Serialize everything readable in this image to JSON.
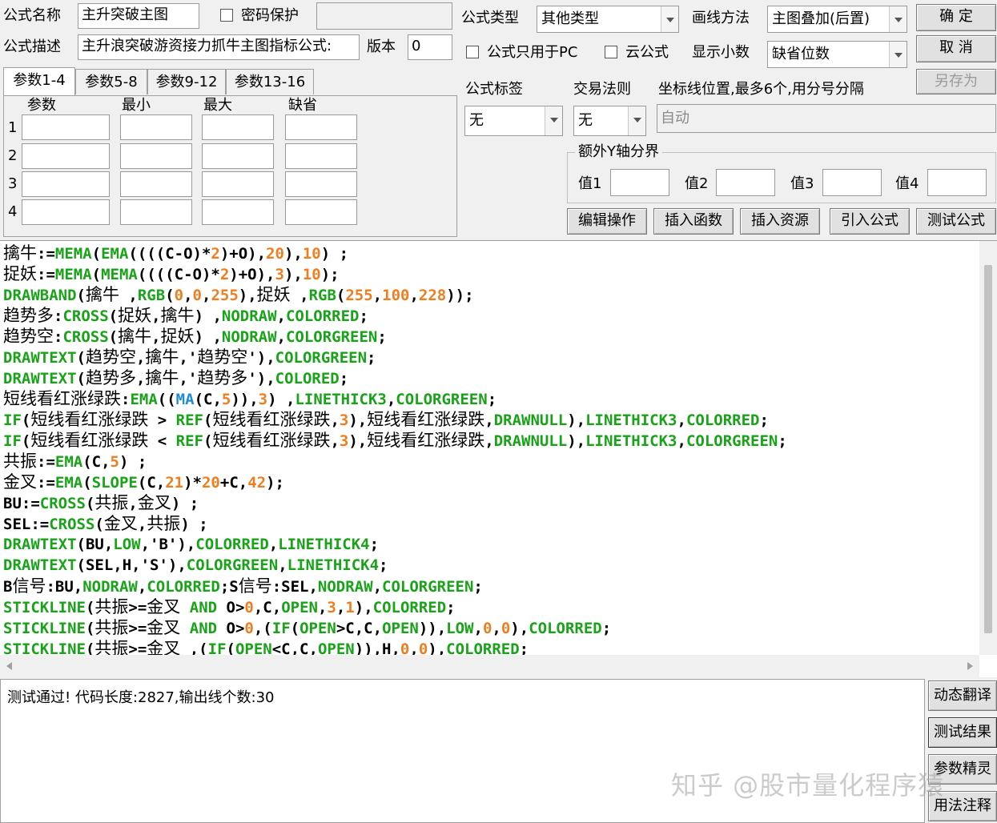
{
  "top": {
    "formula_name_label": "公式名称",
    "formula_name_value": "主升突破主图",
    "password_label": "密码保护",
    "formula_desc_label": "公式描述",
    "formula_desc_value": "主升浪突破游资接力抓牛主图指标公式:",
    "version_label": "版本",
    "version_value": "0",
    "formula_type_label": "公式类型",
    "formula_type_value": "其他类型",
    "draw_method_label": "画线方法",
    "draw_method_value": "主图叠加(后置)",
    "pc_only_label": "公式只用于PC",
    "cloud_label": "云公式",
    "decimals_label": "显示小数",
    "decimals_value": "缺省位数",
    "ok_button": "确 定",
    "cancel_button": "取 消",
    "save_as_button": "另存为"
  },
  "tabs": [
    "参数1-4",
    "参数5-8",
    "参数9-12",
    "参数13-16"
  ],
  "params": {
    "headers": [
      "参数",
      "最小",
      "最大",
      "缺省"
    ],
    "rows": [
      "1",
      "2",
      "3",
      "4"
    ]
  },
  "right": {
    "tag_label": "公式标签",
    "tag_value": "无",
    "trade_rule_label": "交易法则",
    "trade_rule_value": "无",
    "axis_label": "坐标线位置,最多6个,用分号分隔",
    "axis_placeholder": "自动",
    "extra_y_label": "额外Y轴分界",
    "value_labels": [
      "值1",
      "值2",
      "值3",
      "值4"
    ]
  },
  "action_buttons": [
    "编辑操作",
    "插入函数",
    "插入资源",
    "引入公式",
    "测试公式"
  ],
  "code_lines": [
    [
      [
        "cn",
        "擒牛"
      ],
      [
        "k",
        ":="
      ],
      [
        "g",
        "MEMA"
      ],
      [
        "k",
        "("
      ],
      [
        "g",
        "EMA"
      ],
      [
        "k",
        "((((C-O)*"
      ],
      [
        "o",
        "2"
      ],
      [
        "k",
        ")+O),"
      ],
      [
        "o",
        "20"
      ],
      [
        "k",
        "),"
      ],
      [
        "o",
        "10"
      ],
      [
        "k",
        ") ;"
      ]
    ],
    [
      [
        "cn",
        "捉妖"
      ],
      [
        "k",
        ":="
      ],
      [
        "g",
        "MEMA"
      ],
      [
        "k",
        "("
      ],
      [
        "g",
        "MEMA"
      ],
      [
        "k",
        "((((C-O)*"
      ],
      [
        "o",
        "2"
      ],
      [
        "k",
        ")+O),"
      ],
      [
        "o",
        "3"
      ],
      [
        "k",
        "),"
      ],
      [
        "o",
        "10"
      ],
      [
        "k",
        ");"
      ]
    ],
    [
      [
        "g",
        "DRAWBAND"
      ],
      [
        "k",
        "("
      ],
      [
        "cn",
        "擒牛"
      ],
      [
        "k",
        " ,"
      ],
      [
        "g",
        "RGB"
      ],
      [
        "k",
        "("
      ],
      [
        "o",
        "0"
      ],
      [
        "k",
        ","
      ],
      [
        "o",
        "0"
      ],
      [
        "k",
        ","
      ],
      [
        "o",
        "255"
      ],
      [
        "k",
        "),"
      ],
      [
        "cn",
        "捉妖"
      ],
      [
        "k",
        " ,"
      ],
      [
        "g",
        "RGB"
      ],
      [
        "k",
        "("
      ],
      [
        "o",
        "255"
      ],
      [
        "k",
        ","
      ],
      [
        "o",
        "100"
      ],
      [
        "k",
        ","
      ],
      [
        "o",
        "228"
      ],
      [
        "k",
        "));"
      ]
    ],
    [
      [
        "cn",
        "趋势多"
      ],
      [
        "k",
        ":"
      ],
      [
        "g",
        "CROSS"
      ],
      [
        "k",
        "("
      ],
      [
        "cn",
        "捉妖"
      ],
      [
        "k",
        ","
      ],
      [
        "cn",
        "擒牛"
      ],
      [
        "k",
        ") ,"
      ],
      [
        "g",
        "NODRAW"
      ],
      [
        "k",
        ","
      ],
      [
        "g",
        "COLORRED"
      ],
      [
        "k",
        ";"
      ]
    ],
    [
      [
        "cn",
        "趋势空"
      ],
      [
        "k",
        ":"
      ],
      [
        "g",
        "CROSS"
      ],
      [
        "k",
        "("
      ],
      [
        "cn",
        "擒牛"
      ],
      [
        "k",
        ","
      ],
      [
        "cn",
        "捉妖"
      ],
      [
        "k",
        ") ,"
      ],
      [
        "g",
        "NODRAW"
      ],
      [
        "k",
        ","
      ],
      [
        "g",
        "COLORGREEN"
      ],
      [
        "k",
        ";"
      ]
    ],
    [
      [
        "g",
        "DRAWTEXT"
      ],
      [
        "k",
        "("
      ],
      [
        "cn",
        "趋势空"
      ],
      [
        "k",
        ","
      ],
      [
        "cn",
        "擒牛"
      ],
      [
        "k",
        ",'"
      ],
      [
        "cn",
        "趋势空"
      ],
      [
        "k",
        "'),"
      ],
      [
        "g",
        "COLORGREEN"
      ],
      [
        "k",
        ";"
      ]
    ],
    [
      [
        "g",
        "DRAWTEXT"
      ],
      [
        "k",
        "("
      ],
      [
        "cn",
        "趋势多"
      ],
      [
        "k",
        ","
      ],
      [
        "cn",
        "擒牛"
      ],
      [
        "k",
        ",'"
      ],
      [
        "cn",
        "趋势多"
      ],
      [
        "k",
        "'),"
      ],
      [
        "g",
        "COLORED"
      ],
      [
        "k",
        ";"
      ]
    ],
    [
      [
        "cn",
        "短线看红涨绿跌"
      ],
      [
        "k",
        ":"
      ],
      [
        "g",
        "EMA"
      ],
      [
        "k",
        "(("
      ],
      [
        "b",
        "MA"
      ],
      [
        "k",
        "(C,"
      ],
      [
        "o",
        "5"
      ],
      [
        "k",
        ")),"
      ],
      [
        "o",
        "3"
      ],
      [
        "k",
        ") ,"
      ],
      [
        "g",
        "LINETHICK3"
      ],
      [
        "k",
        ","
      ],
      [
        "g",
        "COLORGREEN"
      ],
      [
        "k",
        ";"
      ]
    ],
    [
      [
        "g",
        "IF"
      ],
      [
        "k",
        "("
      ],
      [
        "cn",
        "短线看红涨绿跌"
      ],
      [
        "k",
        " > "
      ],
      [
        "g",
        "REF"
      ],
      [
        "k",
        "("
      ],
      [
        "cn",
        "短线看红涨绿跌"
      ],
      [
        "k",
        ","
      ],
      [
        "o",
        "3"
      ],
      [
        "k",
        "),"
      ],
      [
        "cn",
        "短线看红涨绿跌"
      ],
      [
        "k",
        ","
      ],
      [
        "g",
        "DRAWNULL"
      ],
      [
        "k",
        "),"
      ],
      [
        "g",
        "LINETHICK3"
      ],
      [
        "k",
        ","
      ],
      [
        "g",
        "COLORRED"
      ],
      [
        "k",
        ";"
      ]
    ],
    [
      [
        "g",
        "IF"
      ],
      [
        "k",
        "("
      ],
      [
        "cn",
        "短线看红涨绿跌"
      ],
      [
        "k",
        " < "
      ],
      [
        "g",
        "REF"
      ],
      [
        "k",
        "("
      ],
      [
        "cn",
        "短线看红涨绿跌"
      ],
      [
        "k",
        ","
      ],
      [
        "o",
        "3"
      ],
      [
        "k",
        "),"
      ],
      [
        "cn",
        "短线看红涨绿跌"
      ],
      [
        "k",
        ","
      ],
      [
        "g",
        "DRAWNULL"
      ],
      [
        "k",
        "),"
      ],
      [
        "g",
        "LINETHICK3"
      ],
      [
        "k",
        ","
      ],
      [
        "g",
        "COLORGREEN"
      ],
      [
        "k",
        ";"
      ]
    ],
    [
      [
        "cn",
        "共振"
      ],
      [
        "k",
        ":="
      ],
      [
        "g",
        "EMA"
      ],
      [
        "k",
        "(C,"
      ],
      [
        "o",
        "5"
      ],
      [
        "k",
        ") ;"
      ]
    ],
    [
      [
        "cn",
        "金叉"
      ],
      [
        "k",
        ":="
      ],
      [
        "g",
        "EMA"
      ],
      [
        "k",
        "("
      ],
      [
        "g",
        "SLOPE"
      ],
      [
        "k",
        "(C,"
      ],
      [
        "o",
        "21"
      ],
      [
        "k",
        ")*"
      ],
      [
        "o",
        "20"
      ],
      [
        "k",
        "+C,"
      ],
      [
        "o",
        "42"
      ],
      [
        "k",
        ");"
      ]
    ],
    [
      [
        "k",
        "BU:="
      ],
      [
        "g",
        "CROSS"
      ],
      [
        "k",
        "("
      ],
      [
        "cn",
        "共振"
      ],
      [
        "k",
        ","
      ],
      [
        "cn",
        "金叉"
      ],
      [
        "k",
        ") ;"
      ]
    ],
    [
      [
        "k",
        "SEL:="
      ],
      [
        "g",
        "CROSS"
      ],
      [
        "k",
        "("
      ],
      [
        "cn",
        "金叉"
      ],
      [
        "k",
        ","
      ],
      [
        "cn",
        "共振"
      ],
      [
        "k",
        ") ;"
      ]
    ],
    [
      [
        "g",
        "DRAWTEXT"
      ],
      [
        "k",
        "(BU,"
      ],
      [
        "g",
        "LOW"
      ],
      [
        "k",
        ",'B'),"
      ],
      [
        "g",
        "COLORRED"
      ],
      [
        "k",
        ","
      ],
      [
        "g",
        "LINETHICK4"
      ],
      [
        "k",
        ";"
      ]
    ],
    [
      [
        "g",
        "DRAWTEXT"
      ],
      [
        "k",
        "(SEL,H,'S'),"
      ],
      [
        "g",
        "COLORGREEN"
      ],
      [
        "k",
        ","
      ],
      [
        "g",
        "LINETHICK4"
      ],
      [
        "k",
        ";"
      ]
    ],
    [
      [
        "k",
        "B"
      ],
      [
        "cn",
        "信号"
      ],
      [
        "k",
        ":BU,"
      ],
      [
        "g",
        "NODRAW"
      ],
      [
        "k",
        ","
      ],
      [
        "g",
        "COLORRED"
      ],
      [
        "k",
        ";S"
      ],
      [
        "cn",
        "信号"
      ],
      [
        "k",
        ":SEL,"
      ],
      [
        "g",
        "NODRAW"
      ],
      [
        "k",
        ","
      ],
      [
        "g",
        "COLORGREEN"
      ],
      [
        "k",
        ";"
      ]
    ],
    [
      [
        "g",
        "STICKLINE"
      ],
      [
        "k",
        "("
      ],
      [
        "cn",
        "共振"
      ],
      [
        "k",
        ">="
      ],
      [
        "cn",
        "金叉"
      ],
      [
        "k",
        " "
      ],
      [
        "g",
        "AND"
      ],
      [
        "k",
        " O>"
      ],
      [
        "o",
        "0"
      ],
      [
        "k",
        ",C,"
      ],
      [
        "g",
        "OPEN"
      ],
      [
        "k",
        ","
      ],
      [
        "o",
        "3"
      ],
      [
        "k",
        ","
      ],
      [
        "o",
        "1"
      ],
      [
        "k",
        "),"
      ],
      [
        "g",
        "COLORRED"
      ],
      [
        "k",
        ";"
      ]
    ],
    [
      [
        "g",
        "STICKLINE"
      ],
      [
        "k",
        "("
      ],
      [
        "cn",
        "共振"
      ],
      [
        "k",
        ">="
      ],
      [
        "cn",
        "金叉"
      ],
      [
        "k",
        " "
      ],
      [
        "g",
        "AND"
      ],
      [
        "k",
        " O>"
      ],
      [
        "o",
        "0"
      ],
      [
        "k",
        ",("
      ],
      [
        "g",
        "IF"
      ],
      [
        "k",
        "("
      ],
      [
        "g",
        "OPEN"
      ],
      [
        "k",
        ">C,C,"
      ],
      [
        "g",
        "OPEN"
      ],
      [
        "k",
        ")),"
      ],
      [
        "g",
        "LOW"
      ],
      [
        "k",
        ","
      ],
      [
        "o",
        "0"
      ],
      [
        "k",
        ","
      ],
      [
        "o",
        "0"
      ],
      [
        "k",
        "),"
      ],
      [
        "g",
        "COLORRED"
      ],
      [
        "k",
        ";"
      ]
    ],
    [
      [
        "g",
        "STICKLINE"
      ],
      [
        "k",
        "("
      ],
      [
        "cn",
        "共振"
      ],
      [
        "k",
        ">="
      ],
      [
        "cn",
        "金叉"
      ],
      [
        "k",
        " ,("
      ],
      [
        "g",
        "IF"
      ],
      [
        "k",
        "("
      ],
      [
        "g",
        "OPEN"
      ],
      [
        "k",
        "<C,C,"
      ],
      [
        "g",
        "OPEN"
      ],
      [
        "k",
        ")),H,"
      ],
      [
        "o",
        "0"
      ],
      [
        "k",
        ","
      ],
      [
        "o",
        "0"
      ],
      [
        "k",
        "),"
      ],
      [
        "g",
        "COLORRED"
      ],
      [
        "k",
        ";"
      ]
    ]
  ],
  "output": {
    "message": "测试通过! 代码长度:2827,输出线个数:30"
  },
  "side_buttons": [
    "动态翻译",
    "测试结果",
    "参数精灵",
    "用法注释"
  ],
  "watermark": "知乎 @股市量化程序猿"
}
